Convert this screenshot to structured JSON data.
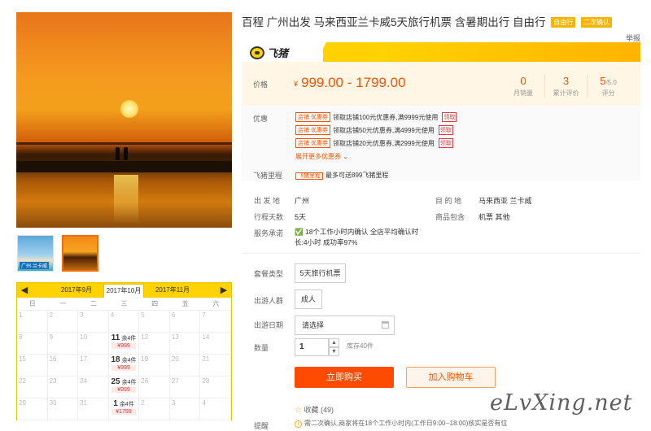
{
  "product": {
    "title": "百程 广州出发 马来西亚兰卡威5天旅行机票 含暑期出行 自由行",
    "badges": [
      "自由行",
      "二次确认"
    ],
    "report_label": "举报"
  },
  "brand": {
    "logo_text": "飞猪"
  },
  "price": {
    "label": "价格",
    "currency": "¥",
    "range": "999.00 - 1799.00",
    "stats": [
      {
        "value": "0",
        "suffix": "",
        "label": "月销量"
      },
      {
        "value": "3",
        "suffix": "",
        "label": "累计评价"
      },
      {
        "value": "5",
        "suffix": "/5.0",
        "label": "评分"
      }
    ]
  },
  "promo": {
    "label": "优惠",
    "coupons": [
      {
        "tag": "店铺  优惠券",
        "text": "领取店铺100元优惠券,满9999元使用",
        "action": "领取"
      },
      {
        "tag": "店铺  优惠券",
        "text": "领取店铺50元优惠券,满4999元使用",
        "action": "领取"
      },
      {
        "tag": "店铺  优惠券",
        "text": "领取店铺20元优惠券,满2999元使用",
        "action": "领取"
      }
    ],
    "more": "展开更多优惠券",
    "miles_label": "飞猪里程",
    "miles_tag": "飞猪里程",
    "miles_text": "最多可送899飞猪里程"
  },
  "info": {
    "departure_label": "出 发 地",
    "departure": "广州",
    "destination_label": "目 的 地",
    "destination": "马来西亚  兰卡威",
    "days_label": "行程天数",
    "days": "5天",
    "includes_label": "商品包含",
    "includes": "机票  其他",
    "service_label": "服务承诺",
    "service": "18个工作小时内确认 全店平均确认时长:4小时 成功率97%"
  },
  "options": {
    "package_label": "套餐类型",
    "package_value": "5天旅行机票",
    "crowd_label": "出游人群",
    "crowd_value": "成人",
    "date_label": "出游日期",
    "date_placeholder": "请选择",
    "qty_label": "数量",
    "qty_value": "1",
    "stock": "库存40件",
    "buy_label": "立即购买",
    "cart_label": "加入购物车",
    "fav_label": "收藏",
    "fav_count": "(49)",
    "remind_label": "提醒",
    "remind_text": "需二次确认,商家将在18个工作小时内(工作日9:00--18:00)核实是否有位"
  },
  "calendar": {
    "months": [
      "2017年9月",
      "2017年10月",
      "2017年11月"
    ],
    "active_month": 1,
    "weekdays": [
      "日",
      "一",
      "二",
      "三",
      "四",
      "五",
      "六"
    ],
    "rows": [
      [
        {
          "d": "1"
        },
        {
          "d": "2"
        },
        {
          "d": "3"
        },
        {
          "d": "4"
        },
        {
          "d": "5"
        },
        {
          "d": "6"
        },
        {
          "d": "7"
        }
      ],
      [
        {
          "d": "8"
        },
        {
          "d": "9"
        },
        {
          "d": "10"
        },
        {
          "d": "11",
          "stock": "余4件",
          "price": "¥999"
        },
        {
          "d": "12"
        },
        {
          "d": "13"
        },
        {
          "d": "14"
        }
      ],
      [
        {
          "d": "15"
        },
        {
          "d": "16"
        },
        {
          "d": "17"
        },
        {
          "d": "18",
          "stock": "余4件",
          "price": "¥999"
        },
        {
          "d": "19"
        },
        {
          "d": "20"
        },
        {
          "d": "21"
        }
      ],
      [
        {
          "d": "22"
        },
        {
          "d": "23"
        },
        {
          "d": "24"
        },
        {
          "d": "25",
          "stock": "余4件",
          "price": "¥999"
        },
        {
          "d": "26"
        },
        {
          "d": "27"
        },
        {
          "d": "28"
        }
      ],
      [
        {
          "d": "29"
        },
        {
          "d": "30"
        },
        {
          "d": "31"
        },
        {
          "d": "1",
          "stock": "余4件",
          "price": "¥1799"
        },
        {
          "d": "2"
        },
        {
          "d": "3"
        },
        {
          "d": "4"
        }
      ]
    ]
  },
  "thumbs": [
    {
      "caption": "广州·兰卡威"
    },
    {
      "caption": ""
    }
  ],
  "watermark": "eLvXing.net"
}
